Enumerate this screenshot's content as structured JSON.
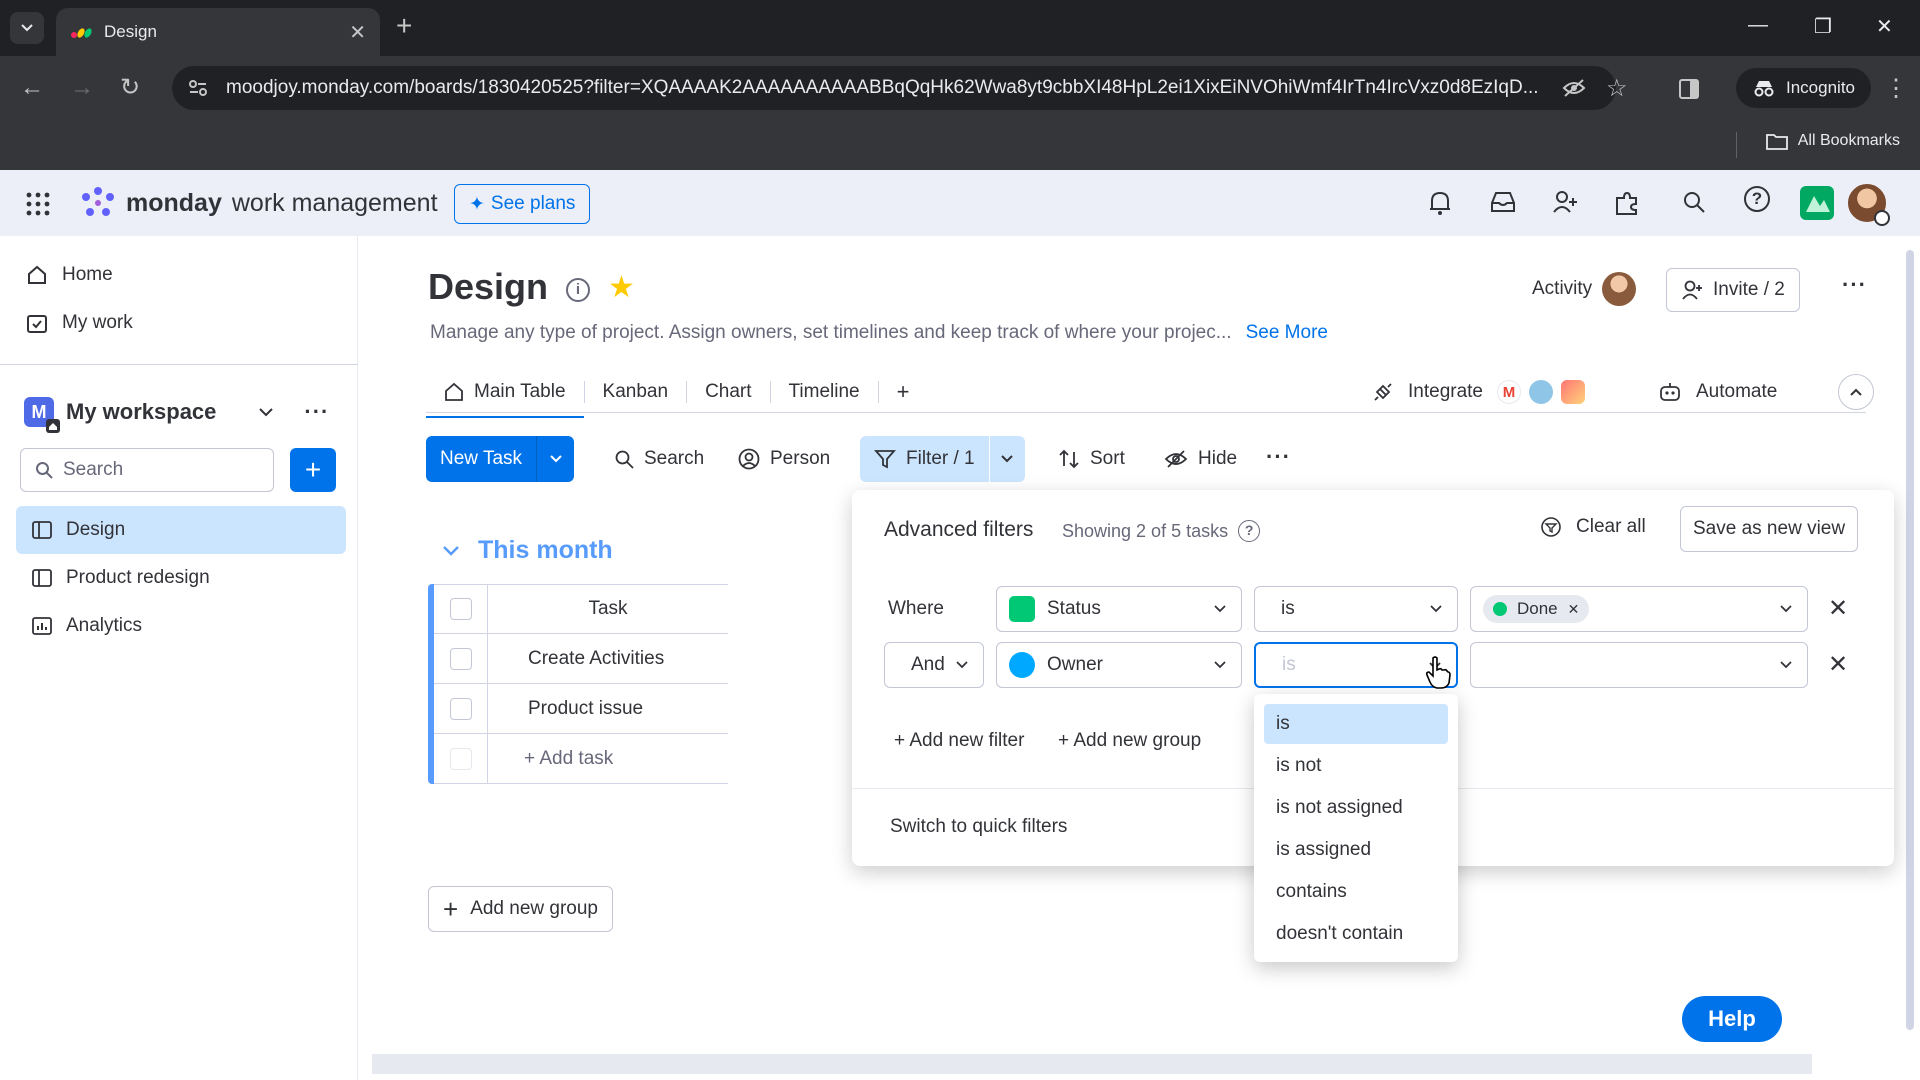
{
  "browser": {
    "tab_title": "Design",
    "url": "moodjoy.monday.com/boards/1830420525?filter=XQAAAAK2AAAAAAAAAABBqQqHk62Wwa8yt9cbbXI48HpL2ei1XixEiNVOhiWmf4IrTn4IrcVxz0d8EzIqD...",
    "incognito_label": "Incognito",
    "bookmarks_label": "All Bookmarks"
  },
  "app": {
    "logo_main": "monday",
    "logo_sub": "work management",
    "see_plans": "See plans"
  },
  "sidebar": {
    "home": "Home",
    "my_work": "My work",
    "workspace_badge": "M",
    "workspace_name": "My workspace",
    "search_placeholder": "Search",
    "boards": [
      {
        "label": "Design"
      },
      {
        "label": "Product redesign"
      },
      {
        "label": "Analytics"
      }
    ]
  },
  "board": {
    "title": "Design",
    "description": "Manage any type of project. Assign owners, set timelines and keep track of where your projec...",
    "see_more": "See More",
    "activity": "Activity",
    "invite": "Invite / 2",
    "views": [
      {
        "label": "Main Table"
      },
      {
        "label": "Kanban"
      },
      {
        "label": "Chart"
      },
      {
        "label": "Timeline"
      }
    ],
    "add_view": "+",
    "integrate": "Integrate",
    "automate": "Automate",
    "toolbar": {
      "new_task": "New Task",
      "search": "Search",
      "person": "Person",
      "filter": "Filter / 1",
      "sort": "Sort",
      "hide": "Hide"
    },
    "group": {
      "title": "This month",
      "column_task": "Task",
      "rows": [
        {
          "task": "Create Activities"
        },
        {
          "task": "Product issue"
        }
      ],
      "add_task": "+ Add task"
    },
    "add_group": "Add new group",
    "help": "Help"
  },
  "filter_panel": {
    "title": "Advanced filters",
    "subtitle": "Showing 2 of 5 tasks",
    "clear_all": "Clear all",
    "save_view": "Save as new view",
    "rule1": {
      "prefix": "Where",
      "column": "Status",
      "operator": "is",
      "value": "Done"
    },
    "rule2": {
      "prefix": "And",
      "column": "Owner",
      "operator_placeholder": "is"
    },
    "add_filter": "+ Add new filter",
    "add_group": "+ Add new group",
    "switch_quick": "Switch to quick filters"
  },
  "operator_menu": {
    "options": [
      "is",
      "is not",
      "is not assigned",
      "is assigned",
      "contains",
      "doesn't contain"
    ]
  },
  "colors": {
    "accent": "#0073ea",
    "group": "#579bfc",
    "status_icon": "#00c875",
    "owner_icon": "#00a9ff",
    "done": "#00c875"
  }
}
